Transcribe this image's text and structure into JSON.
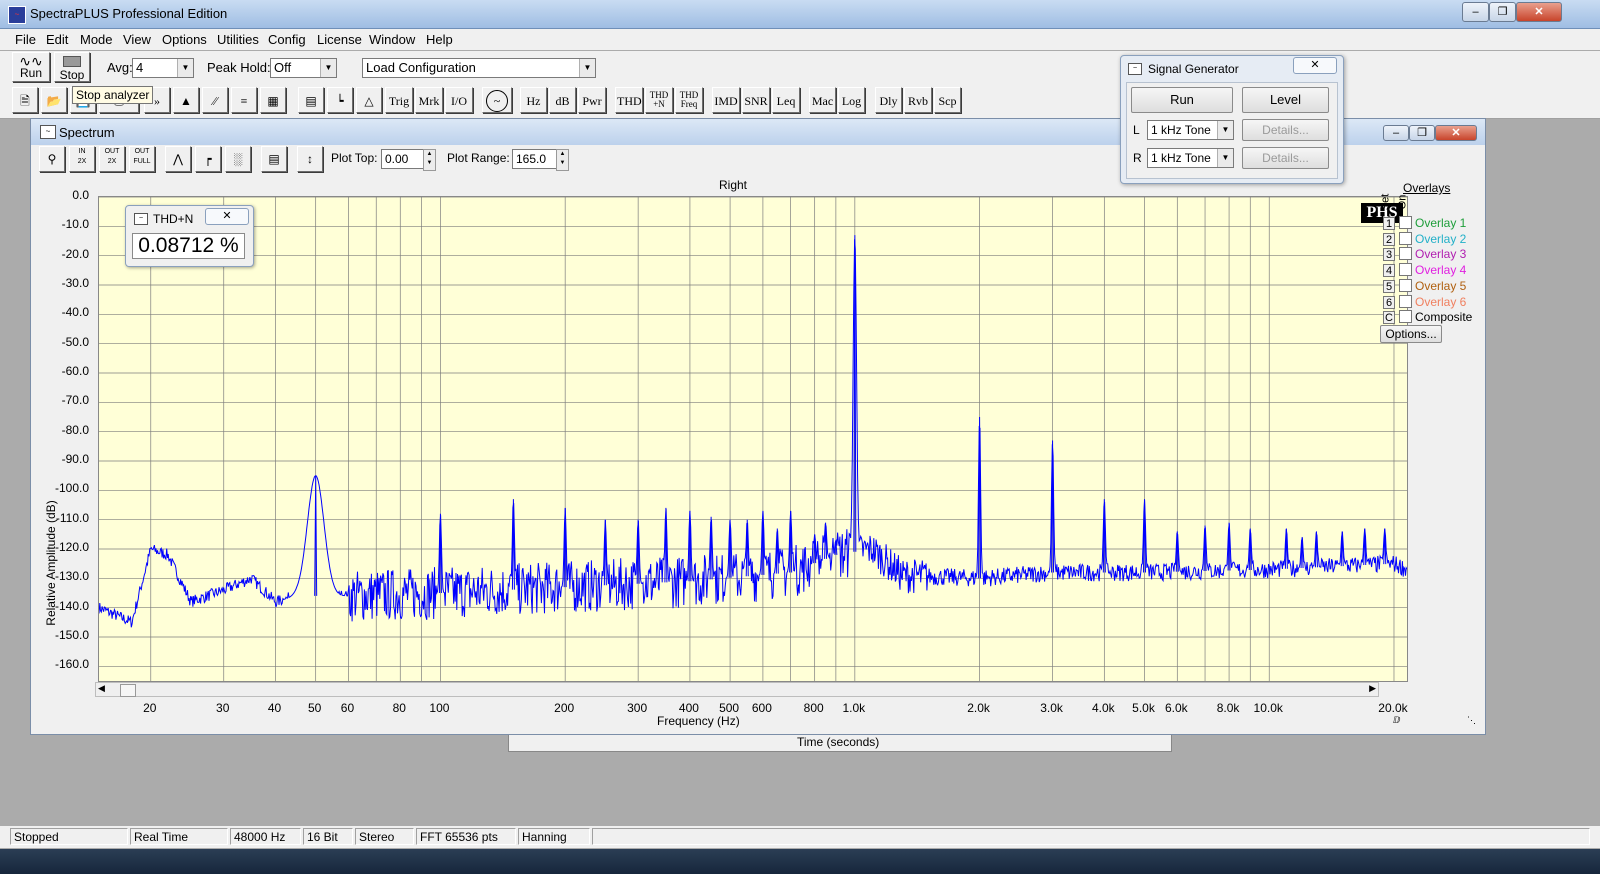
{
  "app": {
    "title": "SpectraPLUS Professional Edition",
    "icon": "spectraplus-app-icon",
    "window_controls": [
      "minimize",
      "maximize",
      "close"
    ]
  },
  "menu": [
    "File",
    "Edit",
    "Mode",
    "View",
    "Options",
    "Utilities",
    "Config",
    "License",
    "Window",
    "Help"
  ],
  "toolbar": {
    "run_label": "Run",
    "stop_label": "Stop",
    "avg_label": "Avg:",
    "avg_value": "4",
    "peak_hold_label": "Peak Hold:",
    "peak_hold_value": "Off",
    "configuration_value": "Load Configuration",
    "tooltip": "Stop analyzer",
    "text_buttons": [
      "Trig",
      "Mrk",
      "I/O",
      "Hz",
      "dB",
      "Pwr",
      "THD",
      "THD +N",
      "THD Freq",
      "IMD",
      "SNR",
      "Leq",
      "Mac",
      "Log",
      "Dly",
      "Rvb",
      "Scp"
    ]
  },
  "spectrum": {
    "title": "Spectrum",
    "plot_top_label": "Plot Top:",
    "plot_top_value": "0.00",
    "plot_range_label": "Plot Range:",
    "plot_range_value": "165.0",
    "channel_label": "Right",
    "logo": "PHS",
    "overlays_title": "Overlays",
    "set_header": "Set",
    "on_header": "On",
    "overlays": [
      {
        "set": "1",
        "label": "Overlay 1",
        "color": "#1e9e3a"
      },
      {
        "set": "2",
        "label": "Overlay 2",
        "color": "#22b0c8"
      },
      {
        "set": "3",
        "label": "Overlay 3",
        "color": "#b01eb0"
      },
      {
        "set": "4",
        "label": "Overlay 4",
        "color": "#e020e0"
      },
      {
        "set": "5",
        "label": "Overlay 5",
        "color": "#b06010"
      },
      {
        "set": "6",
        "label": "Overlay 6",
        "color": "#f08060"
      },
      {
        "set": "C",
        "label": "Composite",
        "color": "#000000"
      }
    ],
    "options_button": "Options..."
  },
  "thd_popup": {
    "title": "THD+N",
    "value": "0.08712 %"
  },
  "signal_generator": {
    "title": "Signal Generator",
    "run_button": "Run",
    "level_button": "Level",
    "left_label": "L",
    "right_label": "R",
    "left_value": "1 kHz Tone",
    "right_value": "1 kHz Tone",
    "details_label": "Details..."
  },
  "behind_window_text": "Time (seconds)",
  "status": [
    "Stopped",
    "Real Time",
    "48000 Hz",
    "16 Bit",
    "Stereo",
    "FFT 65536 pts",
    "Hanning"
  ],
  "chart_data": {
    "type": "line",
    "title": "Right",
    "xlabel": "Frequency (Hz)",
    "ylabel": "Relative Amplitude (dB)",
    "x_scale": "log",
    "xlim": [
      15,
      21500
    ],
    "ylim": [
      -165,
      0
    ],
    "grid": true,
    "line_color": "#0000ff",
    "x_tick_labels": [
      {
        "v": 20,
        "t": "20"
      },
      {
        "v": 30,
        "t": "30"
      },
      {
        "v": 40,
        "t": "40"
      },
      {
        "v": 50,
        "t": "50"
      },
      {
        "v": 60,
        "t": "60"
      },
      {
        "v": 80,
        "t": "80"
      },
      {
        "v": 100,
        "t": "100"
      },
      {
        "v": 200,
        "t": "200"
      },
      {
        "v": 300,
        "t": "300"
      },
      {
        "v": 400,
        "t": "400"
      },
      {
        "v": 500,
        "t": "500"
      },
      {
        "v": 600,
        "t": "600"
      },
      {
        "v": 800,
        "t": "800"
      },
      {
        "v": 1000,
        "t": "1.0k"
      },
      {
        "v": 2000,
        "t": "2.0k"
      },
      {
        "v": 3000,
        "t": "3.0k"
      },
      {
        "v": 4000,
        "t": "4.0k"
      },
      {
        "v": 5000,
        "t": "5.0k"
      },
      {
        "v": 6000,
        "t": "6.0k"
      },
      {
        "v": 8000,
        "t": "8.0k"
      },
      {
        "v": 10000,
        "t": "10.0k"
      },
      {
        "v": 20000,
        "t": "20.0k"
      }
    ],
    "y_tick_labels": [
      "0.0",
      "-10.0",
      "-20.0",
      "-30.0",
      "-40.0",
      "-50.0",
      "-60.0",
      "-70.0",
      "-80.0",
      "-90.0",
      "-100.0",
      "-110.0",
      "-120.0",
      "-130.0",
      "-140.0",
      "-150.0",
      "-160.0"
    ],
    "peaks": [
      {
        "x": 50,
        "y": -95
      },
      {
        "x": 100,
        "y": -108
      },
      {
        "x": 150,
        "y": -103
      },
      {
        "x": 200,
        "y": -106
      },
      {
        "x": 250,
        "y": -110
      },
      {
        "x": 300,
        "y": -110
      },
      {
        "x": 350,
        "y": -106
      },
      {
        "x": 400,
        "y": -107
      },
      {
        "x": 450,
        "y": -109
      },
      {
        "x": 500,
        "y": -110
      },
      {
        "x": 550,
        "y": -110
      },
      {
        "x": 600,
        "y": -107
      },
      {
        "x": 650,
        "y": -113
      },
      {
        "x": 700,
        "y": -107
      },
      {
        "x": 800,
        "y": -115
      },
      {
        "x": 850,
        "y": -111
      },
      {
        "x": 900,
        "y": -117
      },
      {
        "x": 1000,
        "y": -13
      },
      {
        "x": 2000,
        "y": -75
      },
      {
        "x": 3000,
        "y": -83
      },
      {
        "x": 4000,
        "y": -103
      },
      {
        "x": 5000,
        "y": -103
      },
      {
        "x": 6000,
        "y": -114
      },
      {
        "x": 7000,
        "y": -112
      },
      {
        "x": 8000,
        "y": -111
      },
      {
        "x": 9000,
        "y": -113
      },
      {
        "x": 11000,
        "y": -113
      },
      {
        "x": 12000,
        "y": -116
      },
      {
        "x": 13000,
        "y": -114
      },
      {
        "x": 15000,
        "y": -114
      },
      {
        "x": 17000,
        "y": -113
      },
      {
        "x": 19000,
        "y": -113
      }
    ],
    "noise_floor": [
      {
        "x": 15,
        "y": -140
      },
      {
        "x": 18,
        "y": -145
      },
      {
        "x": 20,
        "y": -120
      },
      {
        "x": 22,
        "y": -122
      },
      {
        "x": 25,
        "y": -138
      },
      {
        "x": 30,
        "y": -134
      },
      {
        "x": 35,
        "y": -130
      },
      {
        "x": 40,
        "y": -138
      },
      {
        "x": 45,
        "y": -136
      },
      {
        "x": 60,
        "y": -136
      },
      {
        "x": 100,
        "y": -135
      },
      {
        "x": 200,
        "y": -133
      },
      {
        "x": 400,
        "y": -131
      },
      {
        "x": 700,
        "y": -128
      },
      {
        "x": 900,
        "y": -122
      },
      {
        "x": 1100,
        "y": -120
      },
      {
        "x": 1300,
        "y": -129
      },
      {
        "x": 2000,
        "y": -130
      },
      {
        "x": 3000,
        "y": -128
      },
      {
        "x": 5000,
        "y": -128
      },
      {
        "x": 10000,
        "y": -127
      },
      {
        "x": 20000,
        "y": -125
      },
      {
        "x": 21500,
        "y": -127
      }
    ]
  }
}
